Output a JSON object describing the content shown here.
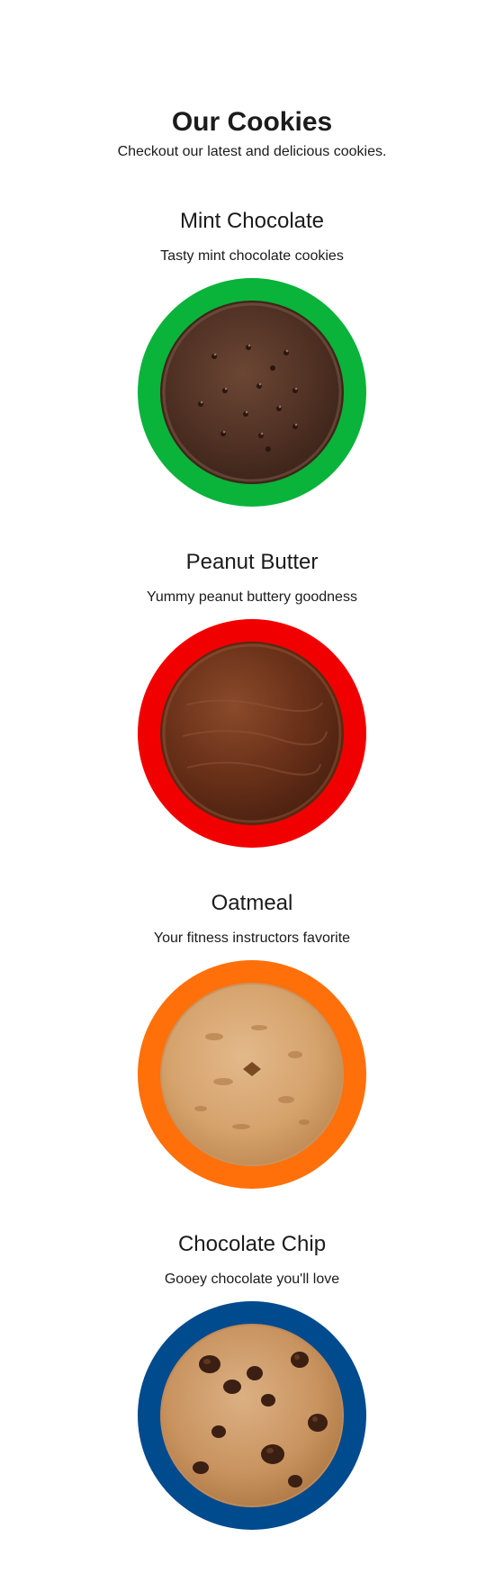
{
  "header": {
    "title": "Our Cookies",
    "subtitle": "Checkout our latest and delicious cookies."
  },
  "cookies": [
    {
      "name": "Mint Chocolate",
      "description": "Tasty mint chocolate cookies",
      "ring_color": "#0ab33a",
      "image": "mint-chocolate-cookie-image"
    },
    {
      "name": "Peanut Butter",
      "description": "Yummy peanut buttery goodness",
      "ring_color": "#f10000",
      "image": "peanut-butter-cookie-image"
    },
    {
      "name": "Oatmeal",
      "description": "Your fitness instructors favorite",
      "ring_color": "#ff700a",
      "image": "oatmeal-cookie-image"
    },
    {
      "name": "Chocolate Chip",
      "description": "Gooey chocolate you'll love",
      "ring_color": "#004a8e",
      "image": "chocolate-chip-cookie-image"
    }
  ]
}
